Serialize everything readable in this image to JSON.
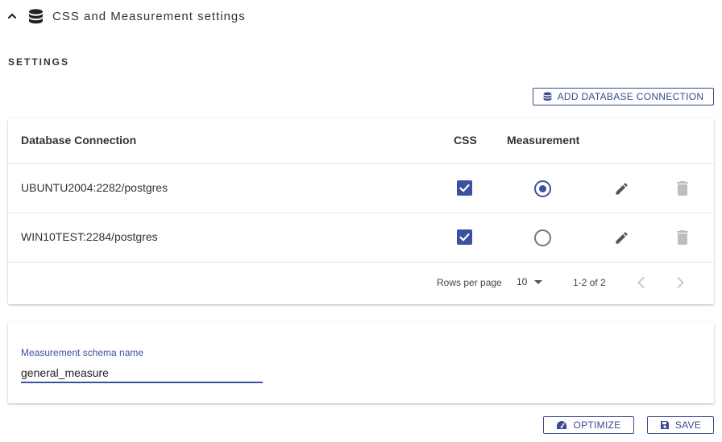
{
  "header": {
    "title": "CSS and Measurement settings",
    "collapse_icon": "chevron-up-icon",
    "icon": "database-icon"
  },
  "settings": {
    "label": "SETTINGS",
    "add_button": {
      "label": "ADD DATABASE CONNECTION",
      "icon": "database-icon"
    }
  },
  "table": {
    "columns": {
      "connection": "Database Connection",
      "css": "CSS",
      "measurement": "Measurement"
    },
    "rows": [
      {
        "connection": "UBUNTU2004:2282/postgres",
        "css": true,
        "measurement": true
      },
      {
        "connection": "WIN10TEST:2284/postgres",
        "css": true,
        "measurement": false
      }
    ],
    "pagination": {
      "rows_per_page_label": "Rows per page",
      "rows_per_page": "10",
      "range": "1-2 of 2"
    }
  },
  "schema": {
    "label": "Measurement schema name",
    "value": "general_measure"
  },
  "footer": {
    "optimize_label": "OPTIMIZE",
    "save_label": "SAVE"
  },
  "colors": {
    "primary": "#3d4fa0",
    "text": "#212121",
    "muted": "#bdbdbd"
  }
}
